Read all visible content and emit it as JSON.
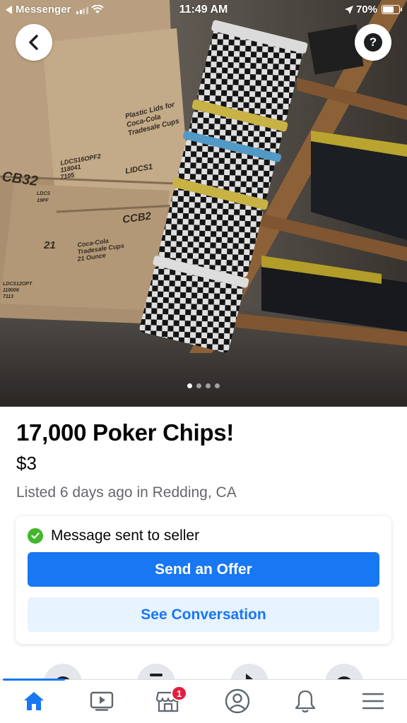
{
  "status_bar": {
    "back_app": "Messenger",
    "time": "11:49 AM",
    "battery": "70%",
    "battery_level": 0.7
  },
  "photo": {
    "image_count": 4,
    "active_index": 0,
    "box_labels": {
      "box_a_lines": [
        "Plastic Lids for",
        "Coca-Cola",
        "Tradesale Cups"
      ],
      "box_a_code_lines": [
        "LDCS16OPF2",
        "118041",
        "7105"
      ],
      "box_a_stamp": "LIDCS1",
      "box_b_code": "CB32",
      "box_b_code_lines": [
        "LDCS",
        "19PF"
      ],
      "box_c_code": "CCB2",
      "box_c_number": "21",
      "box_c_lines": [
        "Coca-Cola",
        "Tradesale Cups",
        "21 Ounce"
      ],
      "box_d_lines": [
        "LDCS12OPT",
        "118006",
        "7113"
      ]
    }
  },
  "listing": {
    "title": "17,000 Poker Chips!",
    "price": "$3",
    "meta": "Listed 6 days ago in Redding, CA"
  },
  "message_card": {
    "status_text": "Message sent to seller",
    "primary_button": "Send an Offer",
    "secondary_button": "See Conversation"
  },
  "tab_bar": {
    "tabs": [
      {
        "icon": "home-icon",
        "active": true
      },
      {
        "icon": "video-icon",
        "active": false
      },
      {
        "icon": "marketplace-icon",
        "active": false,
        "badge": "1"
      },
      {
        "icon": "profile-icon",
        "active": false
      },
      {
        "icon": "bell-icon",
        "active": false
      },
      {
        "icon": "menu-icon",
        "active": false
      }
    ]
  },
  "colors": {
    "accent": "#1877f2",
    "accent_light": "#e7f3ff",
    "success": "#42b72a",
    "badge": "#e41e3f",
    "text_primary": "#050505",
    "text_secondary": "#65676b"
  }
}
